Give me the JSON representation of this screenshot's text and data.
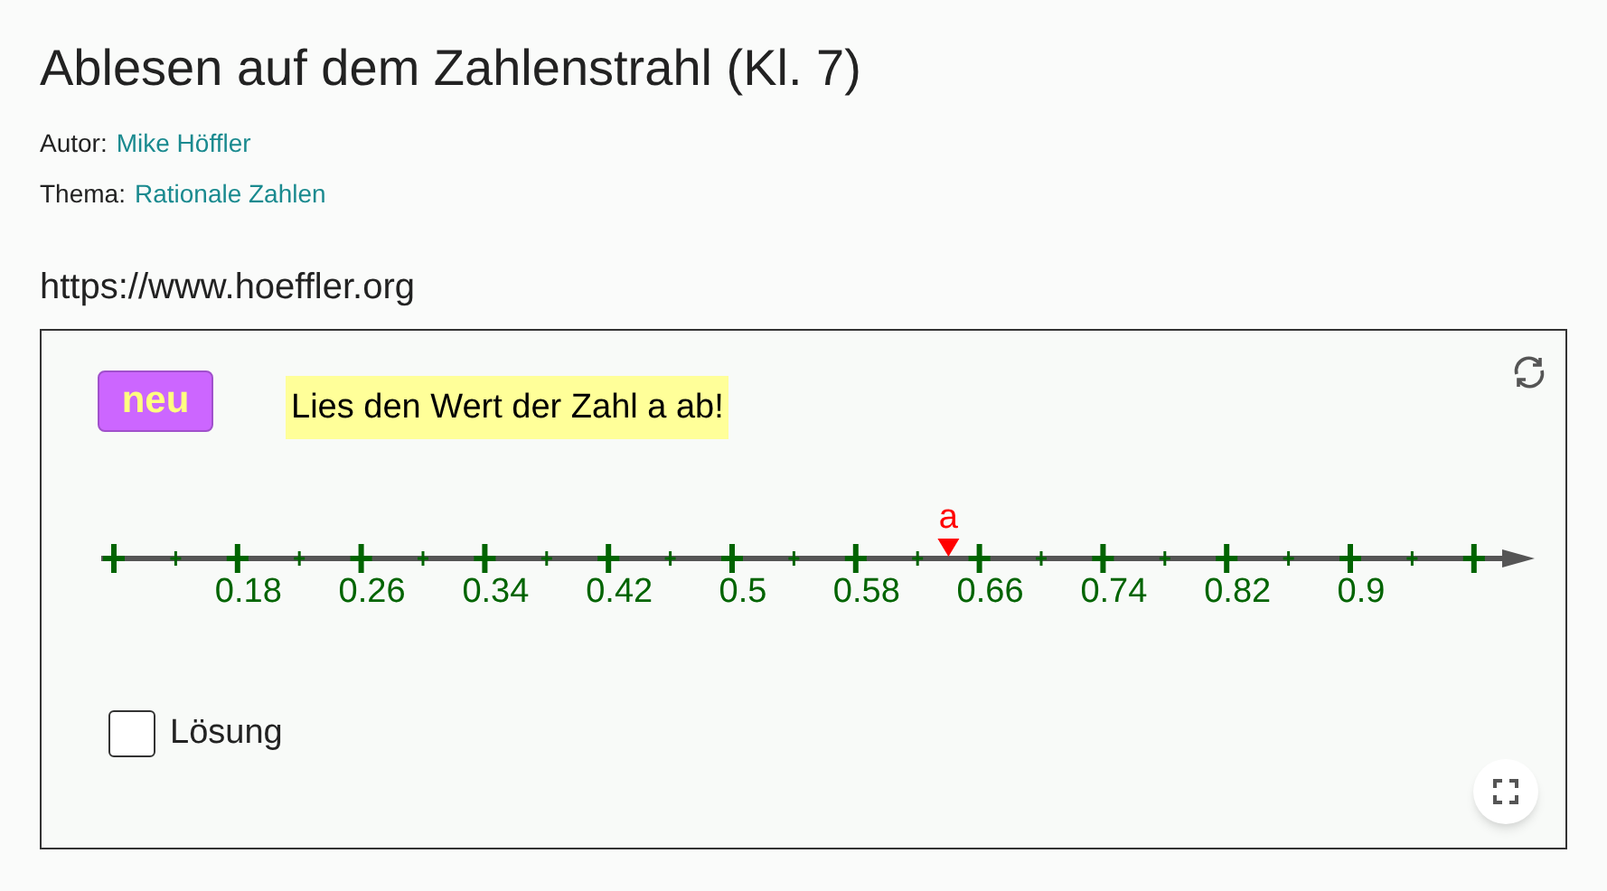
{
  "title": "Ablesen auf dem Zahlenstrahl (Kl. 7)",
  "meta": [
    {
      "label": "Autor:",
      "value": "Mike Höffler"
    },
    {
      "label": "Thema:",
      "value": "Rationale Zahlen"
    }
  ],
  "url": "https://www.hoeffler.org",
  "applet": {
    "new_button": "neu",
    "prompt": "Lies den Wert der Zahl a ab!",
    "number_line": {
      "tick_labels": [
        "0.18",
        "0.26",
        "0.34",
        "0.42",
        "0.5",
        "0.58",
        "0.66",
        "0.74",
        "0.82",
        "0.9"
      ],
      "point_label": "a"
    },
    "solution_checkbox": {
      "label": "Lösung",
      "checked": false
    }
  }
}
